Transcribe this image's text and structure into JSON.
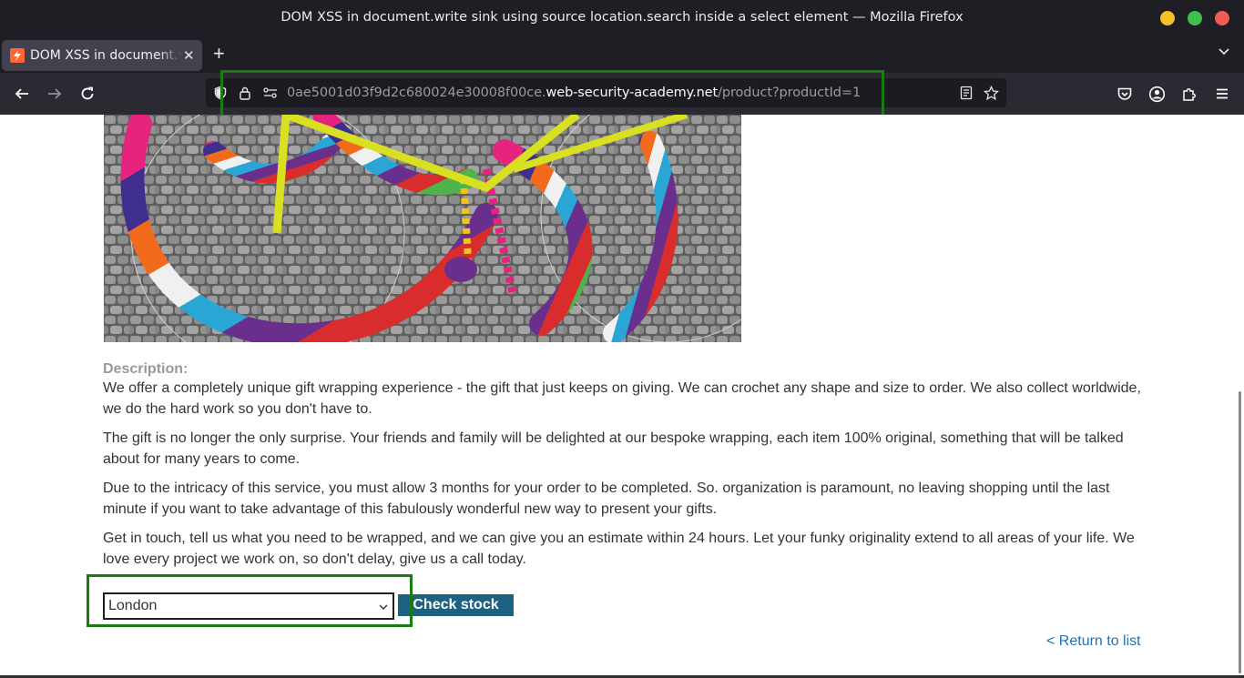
{
  "window": {
    "title": "DOM XSS in document.write sink using source location.search inside a select element — Mozilla Firefox"
  },
  "tab": {
    "label": "DOM XSS in document.write sink using source location.search inside a select element",
    "close_glyph": "✕"
  },
  "toolbar": {
    "new_tab_glyph": "+"
  },
  "urlbar": {
    "url_prefix": "0ae5001d03f9d2c680024e30008f00ce.",
    "url_host": "web-security-academy.net",
    "url_path": "/product?productId=1"
  },
  "product": {
    "image_alt": "Crochet-wrapped bicycle on cobblestones",
    "description_label": "Description:",
    "paragraphs": [
      "We offer a completely unique gift wrapping experience - the gift that just keeps on giving. We can crochet any shape and size to order. We also collect worldwide, we do the hard work so you don't have to.",
      "The gift is no longer the only surprise. Your friends and family will be delighted at our bespoke wrapping, each item 100% original, something that will be talked about for many years to come.",
      "Due to the intricacy of this service, you must allow 3 months for your order to be completed. So. organization is paramount, no leaving shopping until the last minute if you want to take advantage of this fabulously wonderful new way to present your gifts.",
      "Get in touch, tell us what you need to be wrapped, and we can give you an estimate within 24 hours. Let your funky originality extend to all areas of your life. We love every project we work on, so don't delay, give us a call today."
    ]
  },
  "stock": {
    "selected_store": "London",
    "check_label": "Check stock"
  },
  "navigation": {
    "return_label": "< Return to list"
  },
  "colors": {
    "highlight": "#1b7a12",
    "button": "#1d6183",
    "link": "#1f72b5"
  }
}
